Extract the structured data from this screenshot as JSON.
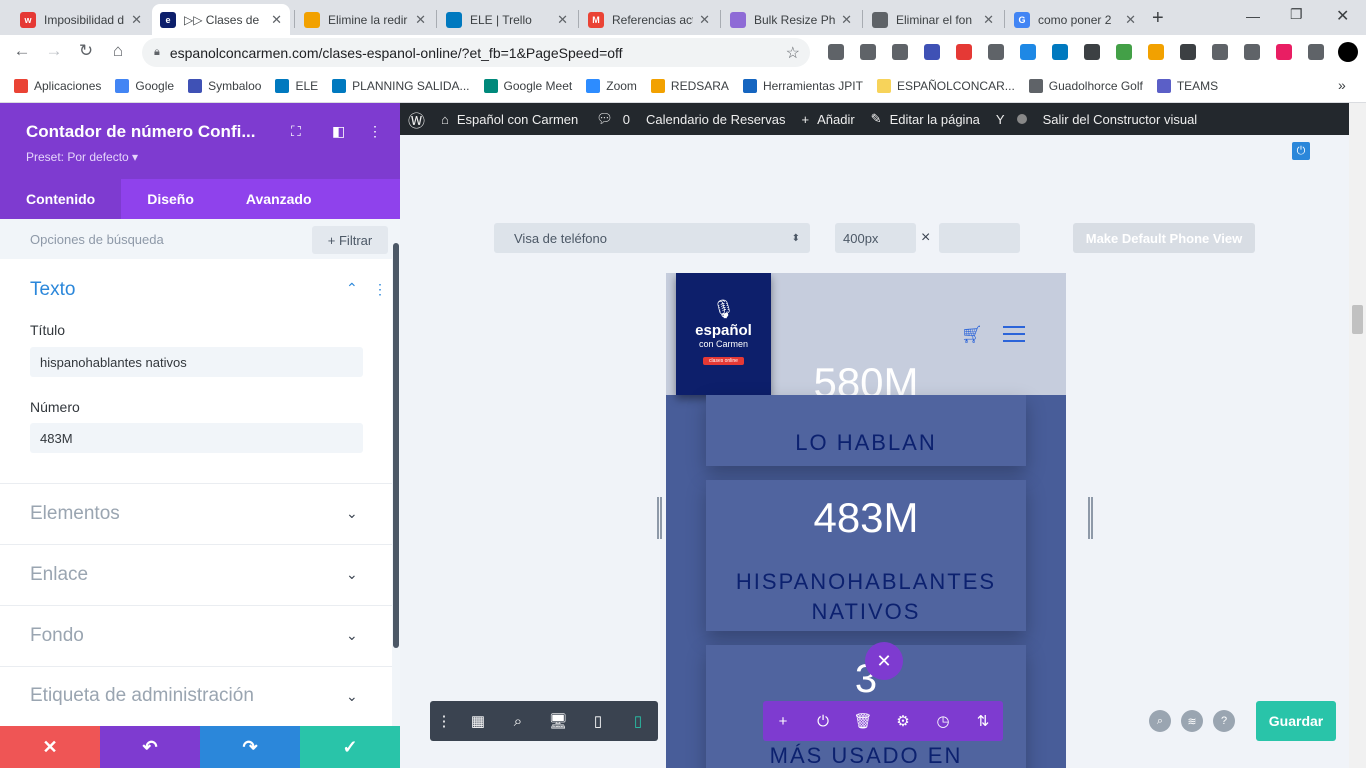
{
  "browser": {
    "tabs": [
      {
        "title": "Imposibilidad d",
        "color": "#e53935",
        "glyph": "w"
      },
      {
        "title": "▷▷ Clases de",
        "color": "#0d1f6b",
        "glyph": "e",
        "active": true
      },
      {
        "title": "Elimine la redir",
        "color": "#f2a100",
        "glyph": ""
      },
      {
        "title": "ELE | Trello",
        "color": "#0079bf",
        "glyph": ""
      },
      {
        "title": "Referencias act",
        "color": "#ea4335",
        "glyph": "M"
      },
      {
        "title": "Bulk Resize Pho",
        "color": "#8e6bd6",
        "glyph": ""
      },
      {
        "title": "Eliminar el fon",
        "color": "#5f6368",
        "glyph": ""
      },
      {
        "title": "como poner 2",
        "color": "#4285f4",
        "glyph": "G"
      }
    ],
    "new_tab": "+",
    "url": "espanolconcarmen.com/clases-espanol-online/?et_fb=1&PageSpeed=off",
    "bookmarks": [
      {
        "label": "Aplicaciones",
        "color": "#ea4335"
      },
      {
        "label": "Google",
        "color": "#4285f4"
      },
      {
        "label": "Symbaloo",
        "color": "#3f51b5"
      },
      {
        "label": "ELE",
        "color": "#0079bf"
      },
      {
        "label": "PLANNING SALIDA...",
        "color": "#0079bf"
      },
      {
        "label": "Google Meet",
        "color": "#00897b"
      },
      {
        "label": "Zoom",
        "color": "#2d8cff"
      },
      {
        "label": "REDSARA",
        "color": "#f2a100"
      },
      {
        "label": "Herramientas JPIT",
        "color": "#1565c0"
      },
      {
        "label": "ESPAÑOLCONCAR...",
        "color": "#f7d35a"
      },
      {
        "label": "Guadolhorce Golf",
        "color": "#5f6368"
      },
      {
        "label": "TEAMS",
        "color": "#5b5fc7"
      }
    ],
    "bookmarks_more": "»"
  },
  "panel": {
    "title": "Contador de número Confi...",
    "preset": "Preset: Por defecto ▾",
    "tabs": [
      "Contenido",
      "Diseño",
      "Avanzado"
    ],
    "search_label": "Opciones de búsqueda",
    "filter_label": "+ Filtrar",
    "text_section": "Texto",
    "title_label": "Título",
    "title_value": "hispanohablantes nativos",
    "number_label": "Número",
    "number_value": "483M",
    "sections": [
      "Elementos",
      "Enlace",
      "Fondo",
      "Etiqueta de administración"
    ]
  },
  "wpbar": {
    "site": "Español con Carmen",
    "comments": "0",
    "calendar": "Calendario de Reservas",
    "add": "Añadir",
    "edit": "Editar la página",
    "exit": "Salir del Constructor visual"
  },
  "preview": {
    "view_select": "Visa de teléfono",
    "width_value": "400px",
    "times": "×",
    "default_button": "Make Default Phone View",
    "logo_text": "español",
    "logo_sub": "con Carmen",
    "logo_tag": "clases online",
    "counters": [
      {
        "number": "580M",
        "label": "LO HABLAN"
      },
      {
        "number": "483M",
        "label": "HISPANOHABLANTES NATIVOS"
      },
      {
        "number": "3",
        "label": "MÁS USADO EN INTERNET"
      }
    ],
    "save": "Guardar"
  },
  "colors": {
    "divi_purple": "#7e3bd0",
    "divi_purple_light": "#8f42ec",
    "save_green": "#29c4a9",
    "redo_blue": "#2b87da",
    "discard_red": "#ef5555"
  }
}
